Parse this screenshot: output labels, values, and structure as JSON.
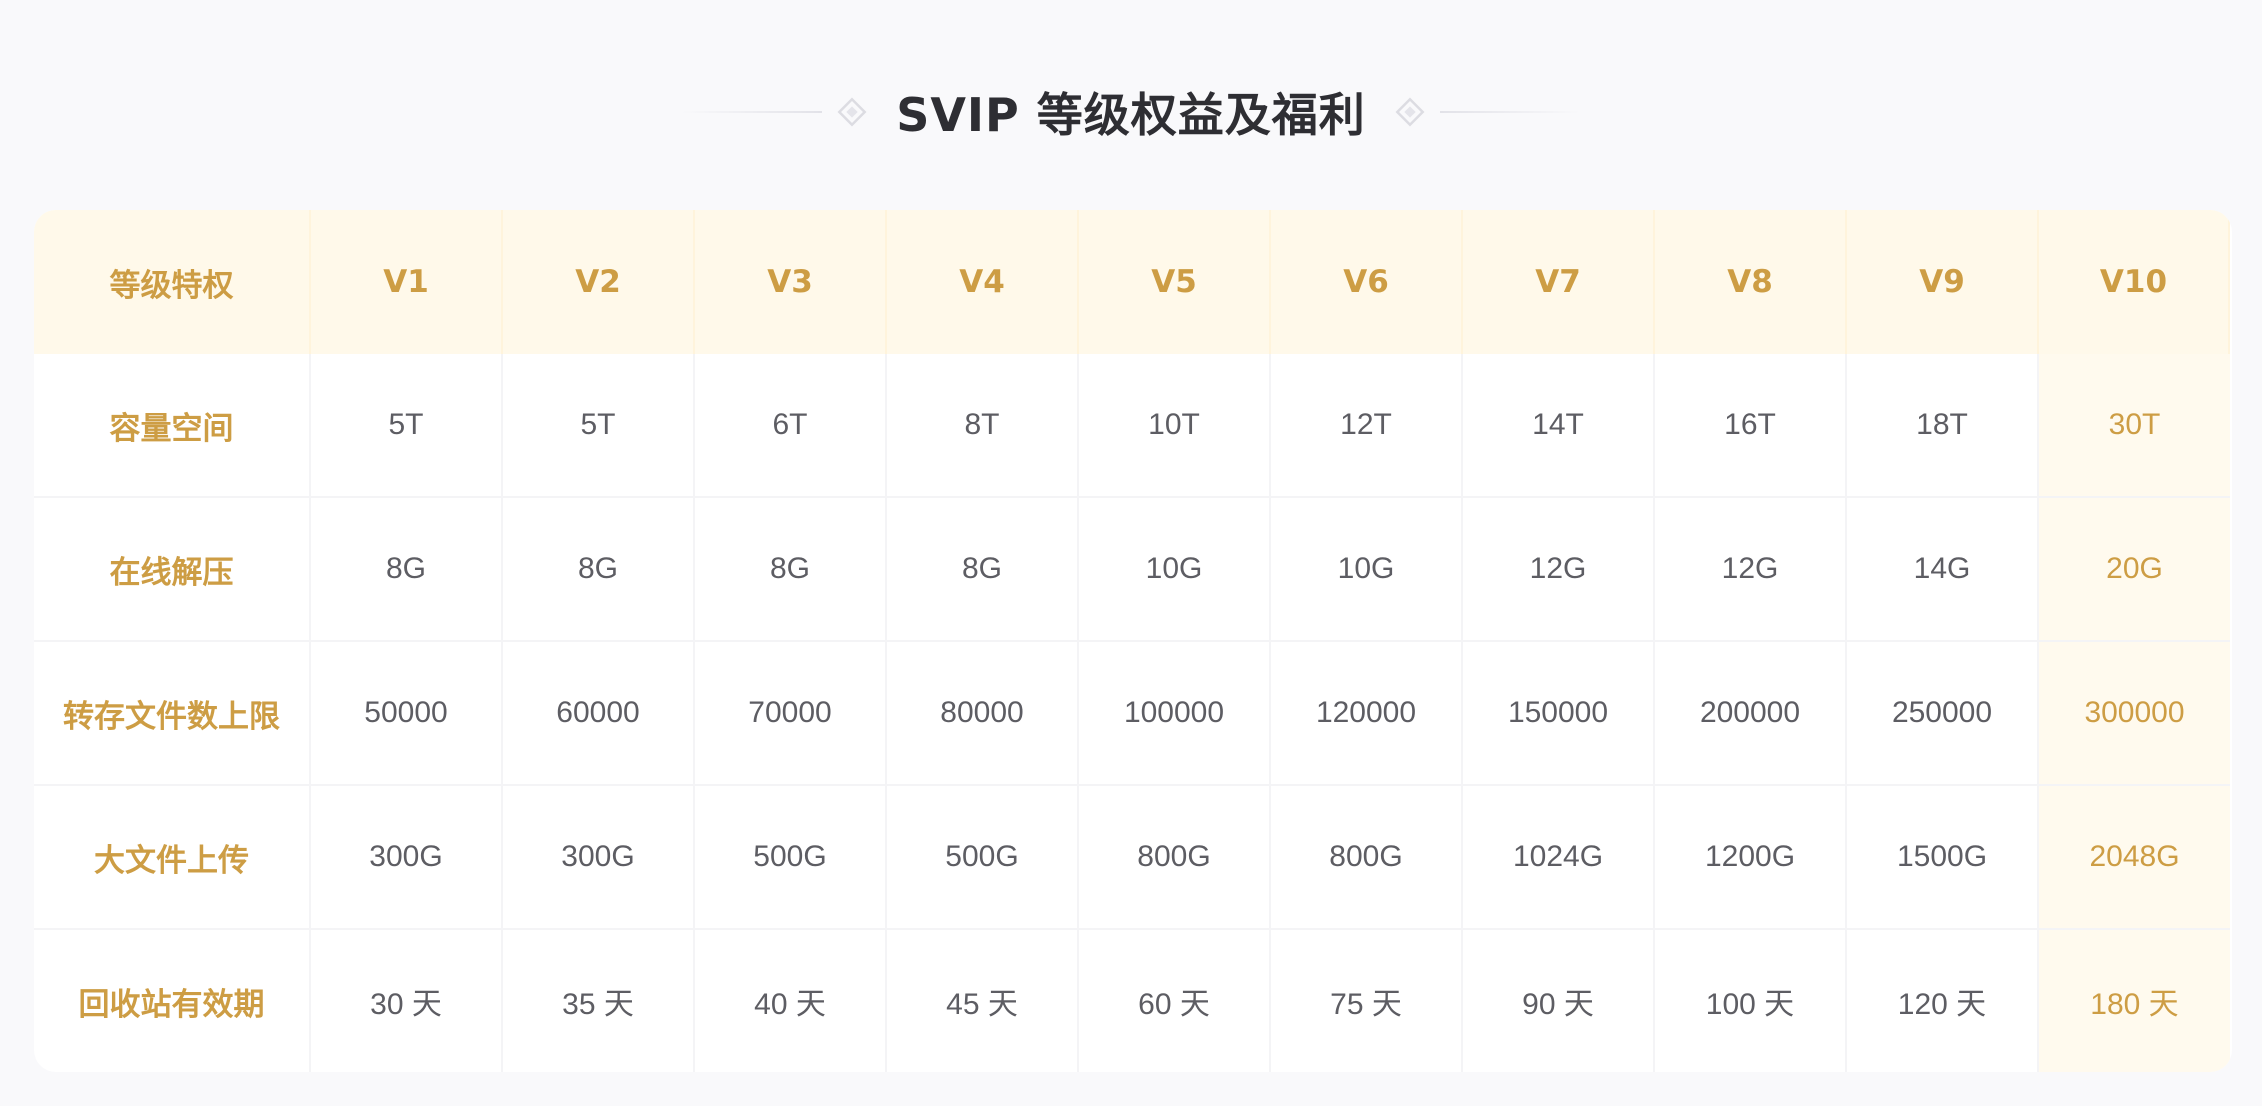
{
  "page_title": "SVIP 等级权益及福利",
  "colors": {
    "accent_gold": "#cd9d44",
    "header_bg": "#fff9ea",
    "page_bg": "#f9f9fb",
    "text_gray": "#5d5d63",
    "title_text": "#2e2e33"
  },
  "icons": {
    "left_ornament": "diamond-ornament-icon",
    "right_ornament": "diamond-ornament-icon"
  },
  "table": {
    "header_label": "等级特权",
    "levels": [
      "V1",
      "V2",
      "V3",
      "V4",
      "V5",
      "V6",
      "V7",
      "V8",
      "V9",
      "V10"
    ],
    "highlighted_level": "V10",
    "rows": [
      {
        "label": "容量空间",
        "values": [
          "5T",
          "5T",
          "6T",
          "8T",
          "10T",
          "12T",
          "14T",
          "16T",
          "18T",
          "30T"
        ]
      },
      {
        "label": "在线解压",
        "values": [
          "8G",
          "8G",
          "8G",
          "8G",
          "10G",
          "10G",
          "12G",
          "12G",
          "14G",
          "20G"
        ]
      },
      {
        "label": "转存文件数上限",
        "values": [
          "50000",
          "60000",
          "70000",
          "80000",
          "100000",
          "120000",
          "150000",
          "200000",
          "250000",
          "300000"
        ]
      },
      {
        "label": "大文件上传",
        "values": [
          "300G",
          "300G",
          "500G",
          "500G",
          "800G",
          "800G",
          "1024G",
          "1200G",
          "1500G",
          "2048G"
        ]
      },
      {
        "label": "回收站有效期",
        "values": [
          "30 天",
          "35 天",
          "40 天",
          "45 天",
          "60 天",
          "75 天",
          "90 天",
          "100 天",
          "120 天",
          "180 天"
        ]
      }
    ]
  }
}
